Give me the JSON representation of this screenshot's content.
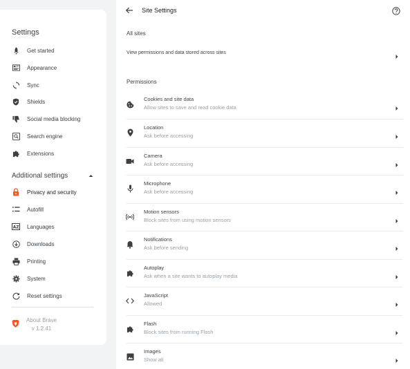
{
  "sidebar": {
    "title": "Settings",
    "items": [
      {
        "label": "Get started",
        "icon": "rocket-icon"
      },
      {
        "label": "Appearance",
        "icon": "appearance-icon"
      },
      {
        "label": "Sync",
        "icon": "sync-icon"
      },
      {
        "label": "Shields",
        "icon": "shield-icon"
      },
      {
        "label": "Social media blocking",
        "icon": "thumbs-down-icon"
      },
      {
        "label": "Search engine",
        "icon": "search-icon"
      },
      {
        "label": "Extensions",
        "icon": "puzzle-icon"
      }
    ],
    "advanced_label": "Additional settings",
    "advanced_items": [
      {
        "label": "Privacy and security",
        "icon": "lock-icon"
      },
      {
        "label": "Autofill",
        "icon": "list-icon"
      },
      {
        "label": "Languages",
        "icon": "languages-icon"
      },
      {
        "label": "Downloads",
        "icon": "download-icon"
      },
      {
        "label": "Printing",
        "icon": "printer-icon"
      },
      {
        "label": "System",
        "icon": "gear-icon"
      },
      {
        "label": "Reset settings",
        "icon": "reset-icon"
      }
    ],
    "about": {
      "label": "About Brave",
      "version": "v 1.2.41"
    }
  },
  "main": {
    "title": "Site Settings",
    "all_sites_heading": "All sites",
    "all_sites_row": "View permissions and data stored across sites",
    "permissions_heading": "Permissions",
    "permissions": [
      {
        "title": "Cookies and site data",
        "subtitle": "Allow sites to save and read cookie data",
        "icon": "cookie-icon"
      },
      {
        "title": "Location",
        "subtitle": "Ask before accessing",
        "icon": "location-pin-icon"
      },
      {
        "title": "Camera",
        "subtitle": "Ask before accessing",
        "icon": "camera-icon"
      },
      {
        "title": "Microphone",
        "subtitle": "Ask before accessing",
        "icon": "microphone-icon"
      },
      {
        "title": "Motion sensors",
        "subtitle": "Block sites from using motion sensors",
        "icon": "motion-sensor-icon"
      },
      {
        "title": "Notifications",
        "subtitle": "Ask before sending",
        "icon": "bell-icon"
      },
      {
        "title": "Autoplay",
        "subtitle": "Ask when a site wants to autoplay media",
        "icon": "puzzle-icon"
      },
      {
        "title": "JavaScript",
        "subtitle": "Allowed",
        "icon": "code-icon"
      },
      {
        "title": "Flash",
        "subtitle": "Block sites from running Flash",
        "icon": "puzzle-icon"
      },
      {
        "title": "Images",
        "subtitle": "Show all",
        "icon": "image-icon"
      }
    ]
  },
  "colors": {
    "accent_red": "#fb542b",
    "text": "#3c4043",
    "secondary_text": "#9aa0a6",
    "background": "#f1f3f4"
  }
}
